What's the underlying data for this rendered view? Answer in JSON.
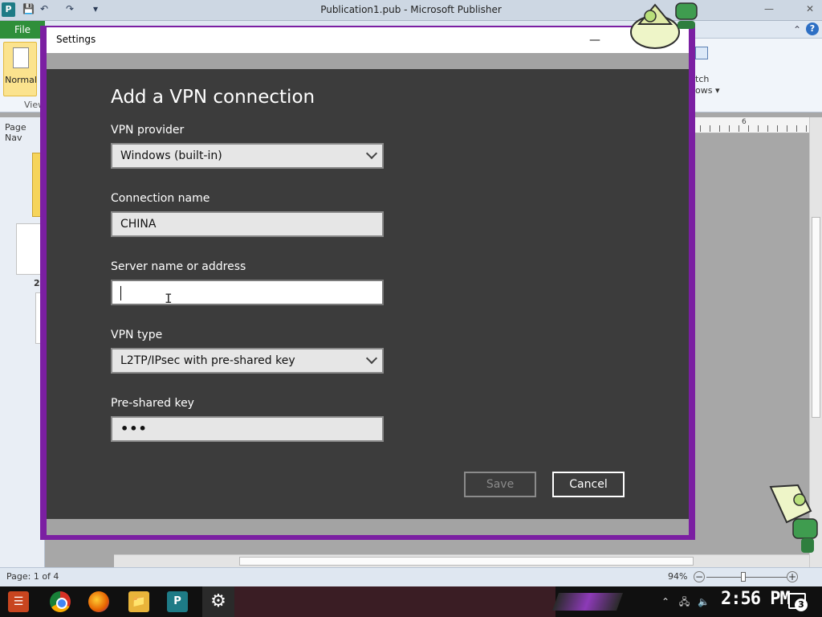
{
  "publisher": {
    "window_title": "Publication1.pub - Microsoft Publisher",
    "app_icon_letter": "P",
    "file_tab": "File",
    "normal_label": "Normal",
    "view_group": "View",
    "switch_windows_label": "tch\nows",
    "pagenav_label": "Page Nav",
    "page_num_2": "2",
    "ruler_num": "6",
    "status_page": "Page: 1 of 4",
    "zoom_level": "94%",
    "help": "?"
  },
  "settings": {
    "window_title": "Settings",
    "heading": "Add a VPN connection",
    "vpn_provider_label": "VPN provider",
    "vpn_provider_value": "Windows (built-in)",
    "connection_name_label": "Connection name",
    "connection_name_value": "CHINA",
    "server_label": "Server name or address",
    "server_value": "",
    "vpn_type_label": "VPN type",
    "vpn_type_value": "L2TP/IPsec with pre-shared key",
    "psk_label": "Pre-shared key",
    "psk_value": "•••",
    "save_label": "Save",
    "cancel_label": "Cancel"
  },
  "taskbar": {
    "clock": "2:56 PM",
    "notification_count": "3",
    "publisher_letter": "P"
  },
  "colors": {
    "dialog_bg": "#3c3c3c",
    "dialog_frame": "#7b1fa2",
    "file_tab": "#2f8f3a"
  }
}
